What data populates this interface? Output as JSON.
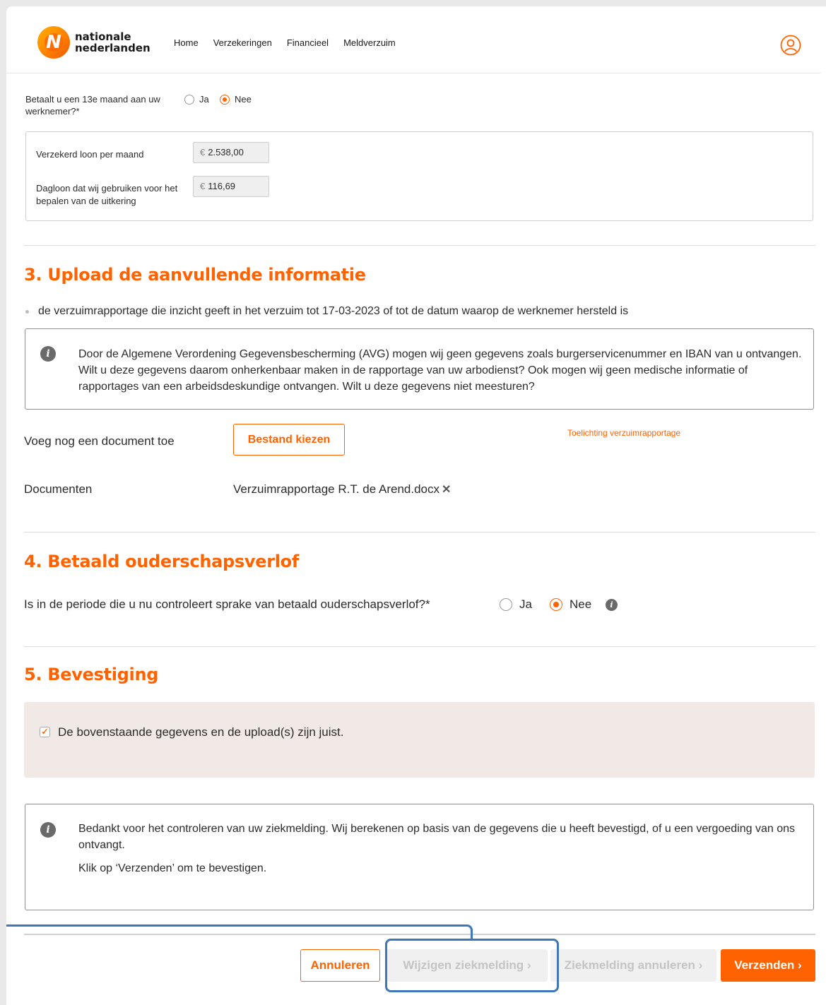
{
  "header": {
    "logo_line1": "nationale",
    "logo_line2": "nederlanden",
    "logo_glyph": "N",
    "nav": [
      "Home",
      "Verzekeringen",
      "Financieel",
      "Meldverzuim"
    ],
    "user_icon": "user-account-icon"
  },
  "salary": {
    "question_13e": "Betaalt u een 13e maand aan uw werknemer?*",
    "options": [
      "Ja",
      "Nee"
    ],
    "selected": "Nee",
    "insured_label": "Verzekerd loon per maand",
    "insured_value": "2.538,00",
    "daily_label": "Dagloon dat wij gebruiken voor het bepalen van de uitkering",
    "daily_value": "116,69",
    "currency": "€"
  },
  "section3": {
    "title": "3. Upload de aanvullende informatie",
    "bullet": "de verzuimrapportage die inzicht geeft in het verzuim tot 17-03-2023 of tot de datum waarop de werknemer hersteld is",
    "info": "Door de Algemene Verordening Gegevensbescherming (AVG) mogen wij geen gegevens zoals burgerservicenummer en IBAN van u ontvangen. Wilt u deze gegevens daarom onherkenbaar maken in de rapportage van uw arbodienst? Ook mogen wij geen medische informatie of rapportages van een arbeidsdeskundige ontvangen. Wilt u deze gegevens niet meesturen?",
    "add_doc_label": "Voeg nog een document toe",
    "choose_file": "Bestand kiezen",
    "explain_link": "Toelichting verzuimrapportage",
    "documents_label": "Documenten",
    "document_name": "Verzuimrapportage R.T. de Arend.docx",
    "remove_glyph": "✕"
  },
  "section4": {
    "title": "4. Betaald ouderschapsverlof",
    "question": "Is in de periode die u nu controleert sprake van betaald ouderschapsverlof?*",
    "options": [
      "Ja",
      "Nee"
    ],
    "selected": "Nee"
  },
  "section5": {
    "title": "5. Bevestiging",
    "checkbox_label": "De bovenstaande gegevens en de upload(s) zijn juist.",
    "checked": true,
    "info_p1": "Bedankt voor het controleren van uw ziekmelding. Wij berekenen op basis van de gegevens die u heeft bevestigd, of u een vergoeding van ons ontvangt.",
    "info_p2": "Klik op ‘Verzenden’ om te bevestigen."
  },
  "footer": {
    "cancel": "Annuleren",
    "change": "Wijzigen ziekmelding",
    "cancel_report": "Ziekmelding annuleren",
    "send": "Verzenden",
    "chevron": "›"
  },
  "colors": {
    "brand": "#ff6200",
    "highlight": "#3f78b4",
    "confirm_bg": "#f1e9e6"
  }
}
